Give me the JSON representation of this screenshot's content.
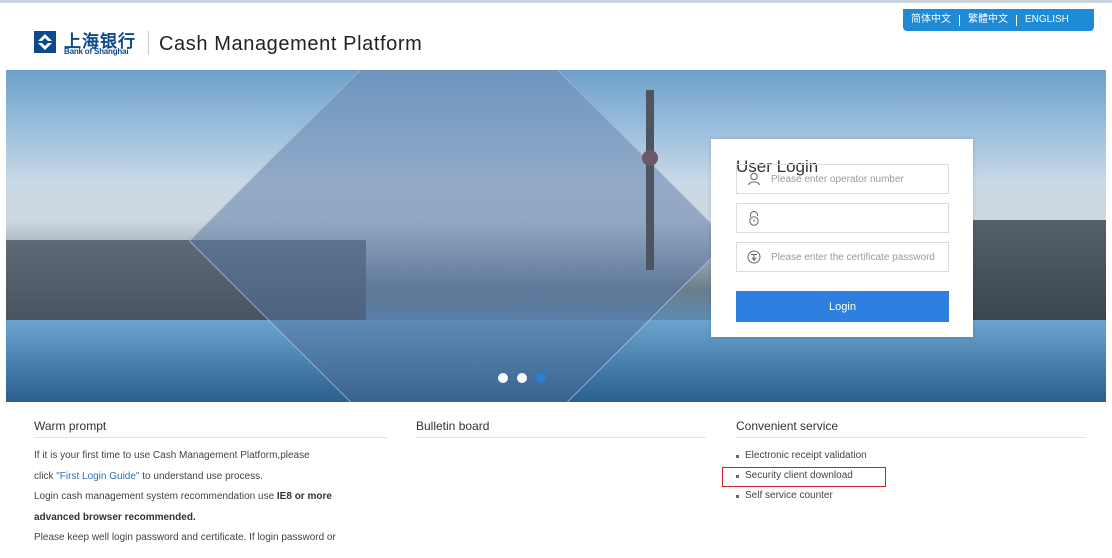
{
  "header": {
    "logo_cn": "上海银行",
    "logo_en": "Bank of Shanghai",
    "platform_title": "Cash Management Platform",
    "languages": [
      "简体中文",
      "繁體中文",
      "ENGLISH"
    ]
  },
  "login": {
    "title": "User Login",
    "operator_placeholder": "Please enter operator number",
    "password_value": "",
    "cert_placeholder": "Please enter the certificate password",
    "button": "Login"
  },
  "carousel": {
    "slide_count": 3,
    "active_index": 2
  },
  "warm_prompt": {
    "title": "Warm prompt",
    "line1": "If it is your first time to use Cash Management Platform,please",
    "line2_pre": "click ",
    "line2_link": "\"First Login Guide\"",
    "line2_post": " to understand use process.",
    "line3_pre": "Login cash management system recommendation use ",
    "line3_bold": "IE8 or more",
    "line4": "advanced browser recommended.",
    "line5": "Please keep well login password and certificate. If login password or"
  },
  "bulletin": {
    "title": "Bulletin board"
  },
  "service": {
    "title": "Convenient service",
    "items": [
      "Electronic receipt validation",
      "Security client download",
      "Self service counter"
    ]
  },
  "colors": {
    "brand_blue": "#0b4a8f",
    "login_button": "#2e80e0",
    "lang_bar": "#1f8ad6",
    "highlight": "#d21f2a"
  }
}
